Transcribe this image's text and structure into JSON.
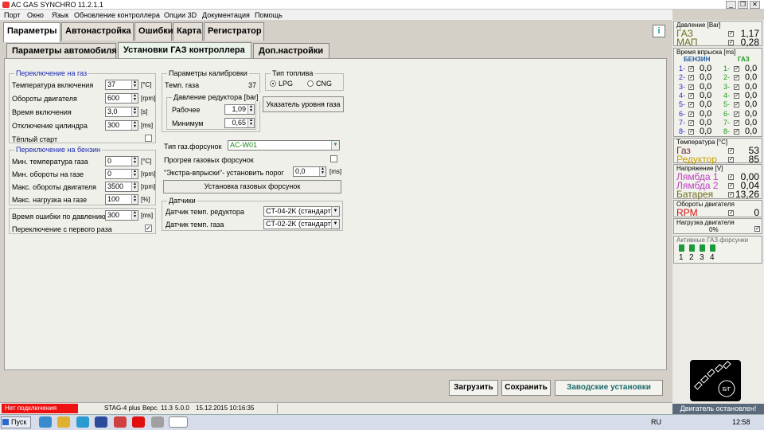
{
  "window": {
    "title": "AC GAS SYNCHRO  11.2.1.1",
    "minimize": "_",
    "restore": "❐",
    "close": "✕"
  },
  "menu": [
    "Порт",
    "Окно",
    "Язык",
    "Обновление контроллера",
    "Опции 3D",
    "Документация",
    "Помощь"
  ],
  "main_tabs": [
    "Параметры",
    "Автонастройка",
    "Ошибки",
    "Карта",
    "Регистратор"
  ],
  "sub_tabs": [
    "Параметры автомобиля",
    "Установки ГАЗ контроллера",
    "Доп.настройки"
  ],
  "gas_switch": {
    "title": "Переключение на газ",
    "rows": [
      {
        "label": "Температура включения",
        "value": "37",
        "unit": "[°C]"
      },
      {
        "label": "Обороты двигателя",
        "value": "600",
        "unit": "[rpm]"
      },
      {
        "label": "Время включения",
        "value": "3,0",
        "unit": "[s]"
      },
      {
        "label": "Отключение цилиндра",
        "value": "300",
        "unit": "[ms]"
      }
    ],
    "warm_start": "Тёплый старт"
  },
  "petrol_switch": {
    "title": "Переключение на бензин",
    "rows": [
      {
        "label": "Мин. температура газа",
        "value": "0",
        "unit": "[°C]"
      },
      {
        "label": "Мин. обороты на газе",
        "value": "0",
        "unit": "[rpm]"
      },
      {
        "label": "Макс. обороты двигателя",
        "value": "3500",
        "unit": "[rpm]"
      },
      {
        "label": "Макс. нагрузка на газе",
        "value": "100",
        "unit": "[%]"
      }
    ]
  },
  "pressure_error": {
    "label": "Время ошибки по давлению",
    "value": "300",
    "unit": "[ms]"
  },
  "first_switch": {
    "label": "Переключение с первого раза",
    "checked": "✓"
  },
  "calibration": {
    "title": "Параметры калибровки",
    "temp_label": "Темп. газа",
    "temp_value": "37"
  },
  "reducer_pressure": {
    "title": "Давление редуктора [bar]",
    "work_label": "Рабочее",
    "work_value": "1,09",
    "min_label": "Минимум",
    "min_value": "0,65"
  },
  "fuel_type": {
    "title": "Тип топлива",
    "lpg": "LPG",
    "cng": "CNG"
  },
  "level_button": "Указатель уровня газа",
  "injectors": {
    "type_label": "Тип газ.форсунок",
    "type_value": "AC-W01",
    "preheat_label": "Прогрев газовых форсунок",
    "extra_label": "\"Экстра-впрыски\"- установить порог",
    "extra_value": "0,0",
    "extra_unit": "[ms]",
    "setup_button": "Установка газовых форсунок"
  },
  "sensors": {
    "title": "Датчики",
    "reducer_label": "Датчик темп. редуктора",
    "reducer_value": "CT-04-2K (стандарт",
    "gas_label": "Датчик темп. газа",
    "gas_value": "CT-02-2K (стандарт"
  },
  "buttons": {
    "load": "Загрузить",
    "save": "Сохранить",
    "factory": "Заводские установки"
  },
  "status": {
    "connection": "Нет подключения",
    "device": "STAG-4 plus",
    "version_label": "Верс.",
    "v1": "11.3",
    "v2": "5.0.0",
    "date": "15.12.2015 10:16:35"
  },
  "right_panel": {
    "pressure": {
      "title": "Давление [Bar]",
      "rows": [
        {
          "label": "ГАЗ",
          "value": "1,17",
          "color": "#6b6b1a"
        },
        {
          "label": "МАП",
          "value": "0,28",
          "color": "#6b6b1a"
        }
      ]
    },
    "injection": {
      "title": "Время впрыска [ms]",
      "col_petrol": "БЕНЗИН",
      "col_gas": "ГАЗ",
      "rows": [
        {
          "p": "1-",
          "pv": "0,0",
          "g": "1-",
          "gv": "0,0"
        },
        {
          "p": "2-",
          "pv": "0,0",
          "g": "2-",
          "gv": "0,0"
        },
        {
          "p": "3-",
          "pv": "0,0",
          "g": "3-",
          "gv": "0,0"
        },
        {
          "p": "4-",
          "pv": "0,0",
          "g": "4-",
          "gv": "0,0"
        },
        {
          "p": "5-",
          "pv": "0,0",
          "g": "5-",
          "gv": "0,0"
        },
        {
          "p": "6-",
          "pv": "0,0",
          "g": "6-",
          "gv": "0,0"
        },
        {
          "p": "7-",
          "pv": "0,0",
          "g": "7-",
          "gv": "0,0"
        },
        {
          "p": "8-",
          "pv": "0,0",
          "g": "8-",
          "gv": "0,0"
        }
      ]
    },
    "temperature": {
      "title": "Температура [°C]",
      "rows": [
        {
          "label": "Газ",
          "value": "53",
          "color": "#6b2a2a"
        },
        {
          "label": "Редуктор",
          "value": "85",
          "color": "#c8a000"
        }
      ]
    },
    "voltage": {
      "title": "Напряжение [V]",
      "rows": [
        {
          "label": "Лямбда 1",
          "value": "0,00",
          "color": "#c040c0"
        },
        {
          "label": "Лямбда 2",
          "value": "0,04",
          "color": "#c040c0"
        },
        {
          "label": "Батарея",
          "value": "13,26",
          "color": "#6b6b1a"
        }
      ]
    },
    "rpm": {
      "title": "Обороты двигателя",
      "label": "RPM",
      "value": "0"
    },
    "load": {
      "title": "Нагрузка двигателя",
      "value": "0%"
    },
    "active": {
      "title": "Активные ГАЗ.форсунки",
      "nums": [
        "1",
        "2",
        "3",
        "4"
      ]
    },
    "bg_label": "Б/Г",
    "engine_status": "Двигатель остановлен!"
  },
  "taskbar": {
    "start": "Пуск",
    "lang": "RU",
    "time": "12:58"
  },
  "check": "✓",
  "colors": {
    "petrol_num": "#2a2ad0",
    "gas_num": "#1a9a1a",
    "rpm_label": "#d01010",
    "status_red": "#ee1111",
    "active_tab": "#ffffff"
  }
}
